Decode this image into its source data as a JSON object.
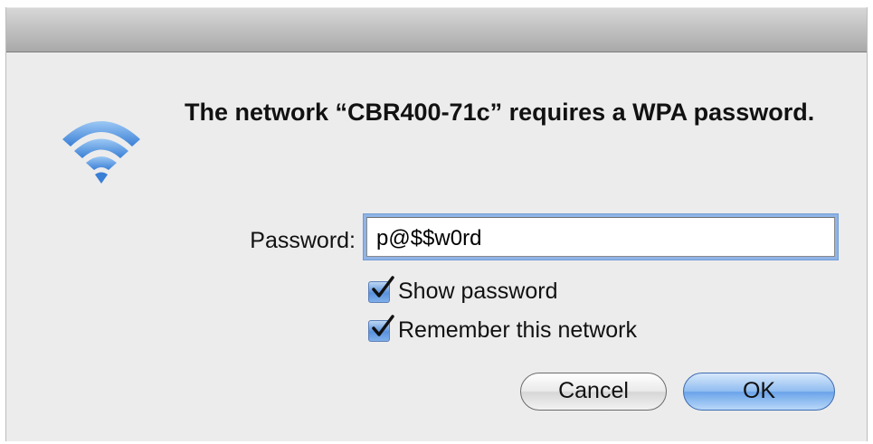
{
  "dialog": {
    "message": "The network “CBR400-71c” requires a WPA password.",
    "password_label": "Password:",
    "password_value": "p@$$w0rd",
    "show_password": {
      "label": "Show password",
      "checked": true
    },
    "remember_network": {
      "label": "Remember this network",
      "checked": true
    },
    "cancel_label": "Cancel",
    "ok_label": "OK"
  },
  "icons": {
    "wifi": "wifi-icon",
    "checkmark": "checkmark-icon"
  },
  "colors": {
    "accent": "#5a92dd",
    "wifi": "#4a90e2",
    "window_bg": "#ececec"
  }
}
